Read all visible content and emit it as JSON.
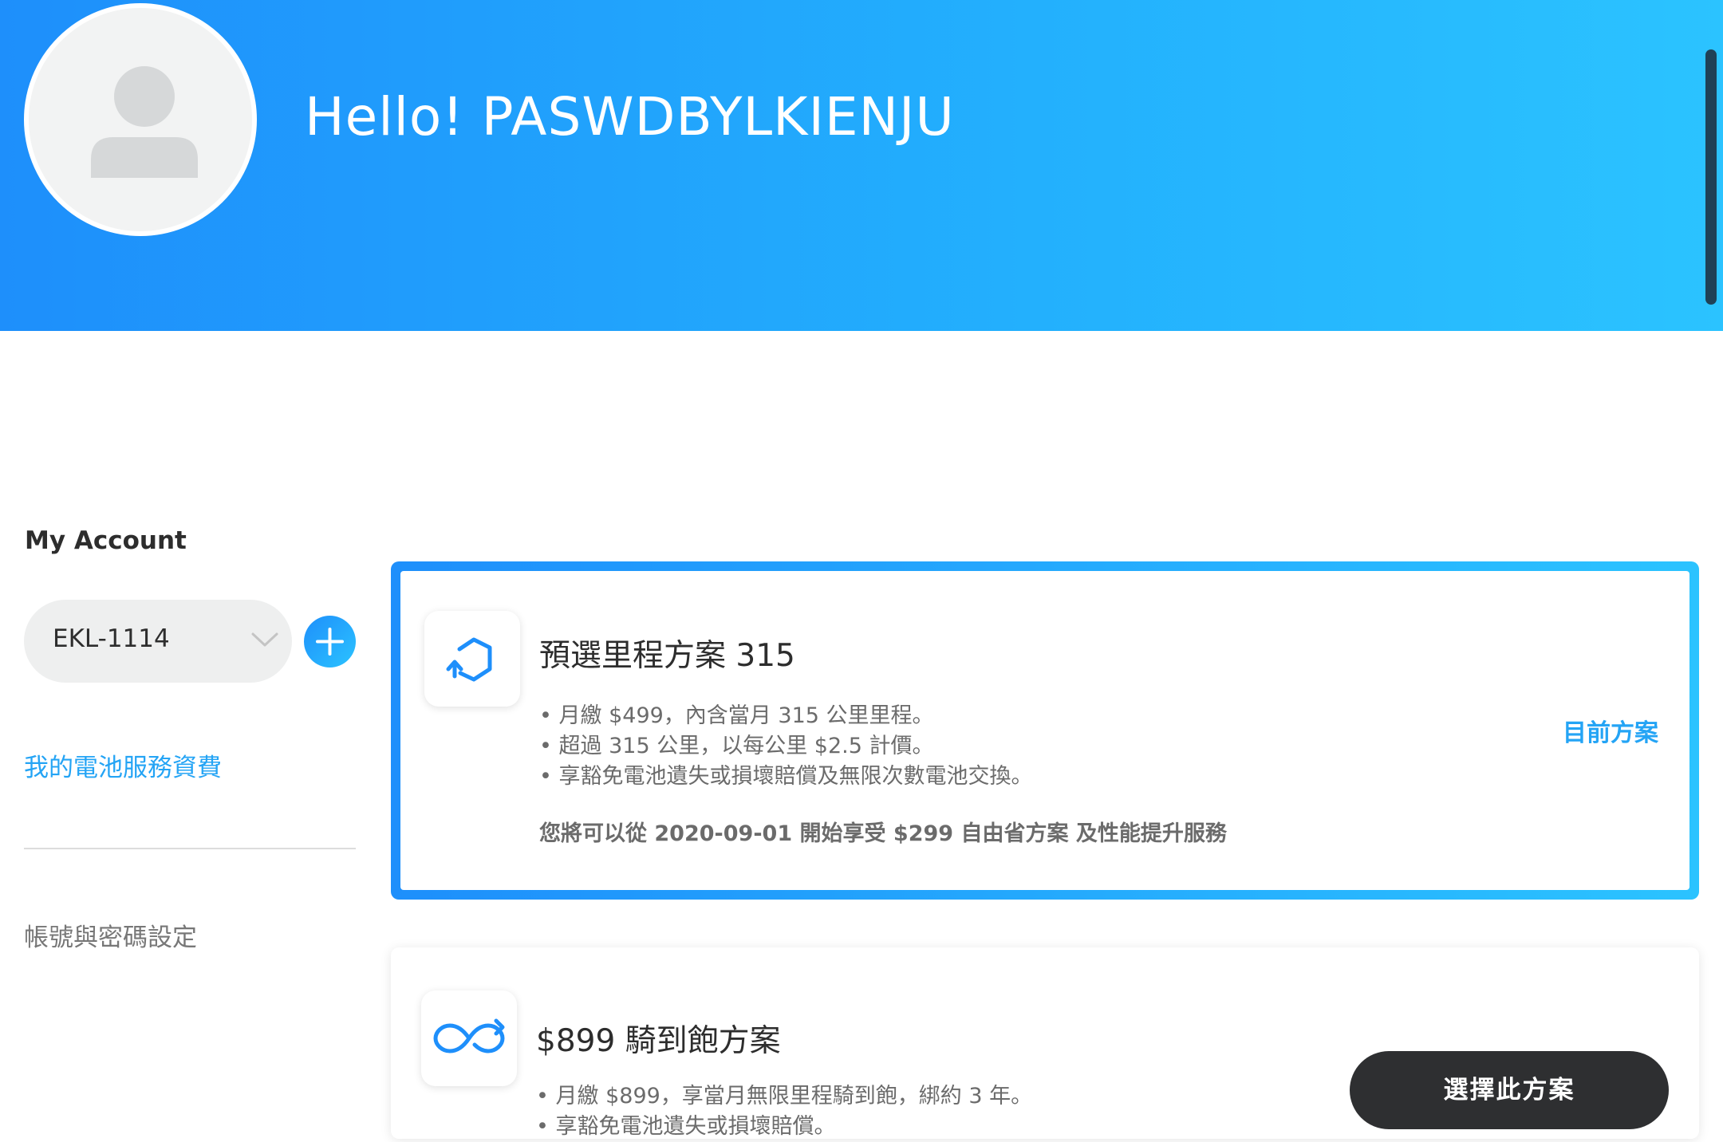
{
  "header": {
    "greeting": "Hello! PASWDBYLKIENJU",
    "avatar_icon": "user-placeholder-icon"
  },
  "sidebar": {
    "title": "My Account",
    "vehicle_select": {
      "value": "EKL-1114",
      "icon": "chevron-down-icon"
    },
    "add_icon": "plus-icon",
    "items": [
      {
        "label": "我的電池服務資費",
        "active": true
      },
      {
        "label": "帳號與密碼設定",
        "active": false
      }
    ]
  },
  "plans": [
    {
      "icon": "hexagon-refresh-icon",
      "title": "預選里程方案 315",
      "bullets": [
        "月繳 $499，內含當月 315 公里里程。",
        "超過 315 公里，以每公里 $2.5 計價。",
        "享豁免電池遺失或損壞賠償及無限次數電池交換。"
      ],
      "promo": "您將可以從 2020-09-01 開始享受 $299 自由省方案 及性能提升服務",
      "status_label": "目前方案"
    },
    {
      "icon": "infinity-refresh-icon",
      "title": "$899 騎到飽方案",
      "bullets": [
        "月繳 $899，享當月無限里程騎到飽，綁約 3 年。",
        "享豁免電池遺失或損壞賠償。"
      ],
      "action_label": "選擇此方案"
    }
  ],
  "colors": {
    "accent": "#24a4f5",
    "gradient_start": "#1e8ffb",
    "gradient_end": "#2bc3ff",
    "button_dark": "#2e2f31"
  }
}
